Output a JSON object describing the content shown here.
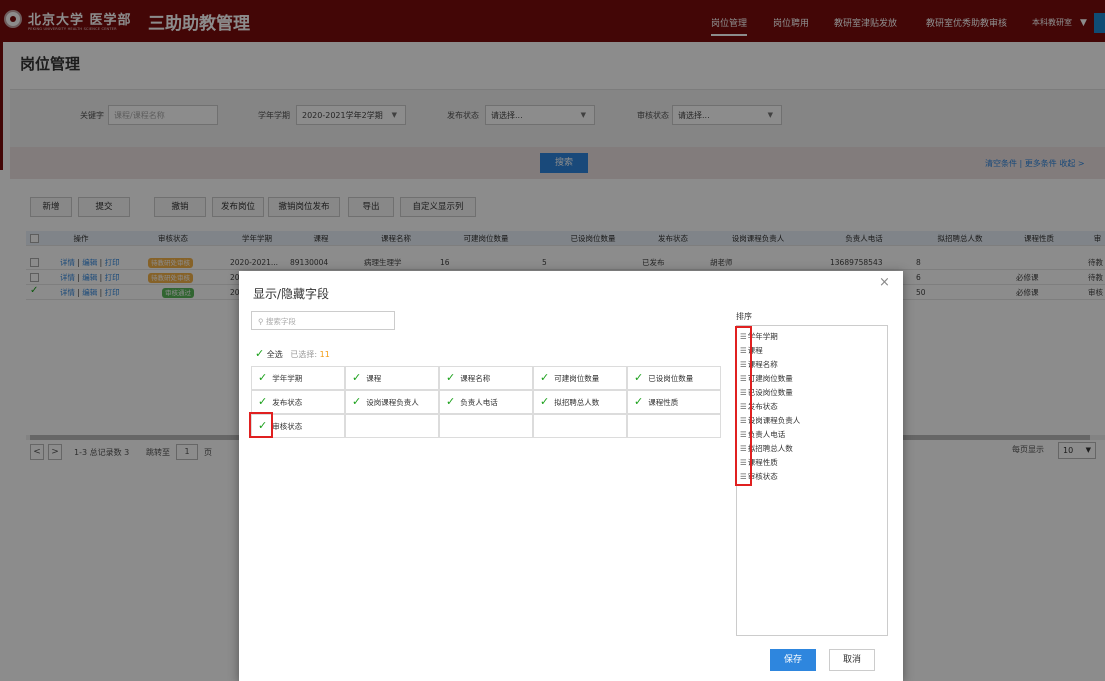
{
  "header": {
    "brand": "北京大学 医学部",
    "brand_sub": "PEKING UNIVERSITY HEALTH SCIENCE CENTER",
    "app_title": "三助助教管理",
    "nav": [
      "岗位管理",
      "岗位聘用",
      "教研室津贴发放",
      "教研室优秀助教审核",
      "本科教研室"
    ],
    "nav_caret": "▼"
  },
  "page": {
    "title": "岗位管理"
  },
  "filters": {
    "keyword_label": "关键字",
    "keyword_placeholder": "课程/课程名称",
    "term_label": "学年学期",
    "term_value": "2020-2021学年2学期",
    "publish_label": "发布状态",
    "publish_value": "请选择...",
    "review_label": "审核状态",
    "review_value": "请选择...",
    "search_button": "搜索",
    "links": "清空条件 | 更多条件  收起 >"
  },
  "toolbar": [
    "新增",
    "提交",
    "撤销",
    "发布岗位",
    "撤销岗位发布",
    "导出",
    "自定义显示列"
  ],
  "table": {
    "headers": [
      "操作",
      "审核状态",
      "学年学期",
      "课程",
      "课程名称",
      "可建岗位数量",
      "已设岗位数量",
      "发布状态",
      "设岗课程负责人",
      "负责人电话",
      "拟招聘总人数",
      "课程性质",
      "审"
    ],
    "rows": [
      {
        "ops": [
          "详情",
          "编辑",
          "打印"
        ],
        "status": "待教研处审核",
        "term": "2020-2021...",
        "course": "89130004",
        "name": "病理生理学",
        "can": "16",
        "set": "5",
        "pub": "已发布",
        "owner": "胡老师",
        "phone": "13689758543",
        "total": "8",
        "nature": "",
        "last": "待教"
      },
      {
        "ops": [
          "详情",
          "编辑",
          "打印"
        ],
        "status": "待教研处审核",
        "term": "20",
        "course": "",
        "name": "",
        "can": "",
        "set": "",
        "pub": "",
        "owner": "",
        "phone": "",
        "total": "6",
        "nature": "必修课",
        "last": "待教"
      },
      {
        "ops": [
          "详情",
          "编辑",
          "打印"
        ],
        "status": "审核通过",
        "term": "20",
        "course": "",
        "name": "",
        "can": "",
        "set": "",
        "pub": "",
        "owner": "",
        "phone": "",
        "total": "50",
        "nature": "必修课",
        "last": "审核"
      }
    ]
  },
  "pager": {
    "prev": "<",
    "next": ">",
    "summary": "1-3 总记录数 3",
    "goto_label": "跳转至",
    "goto_value": "1",
    "page_unit": "页",
    "per_page_label": "每页显示",
    "per_page_value": "10"
  },
  "modal": {
    "title": "显示/隐藏字段",
    "close": "×",
    "search_placeholder": "搜索字段",
    "select_all": "全选",
    "selected_label": "已选择:",
    "selected_count": "11",
    "fields": [
      "学年学期",
      "课程",
      "课程名称",
      "可建岗位数量",
      "已设岗位数量",
      "发布状态",
      "设岗课程负责人",
      "负责人电话",
      "拟招聘总人数",
      "课程性质",
      "审核状态"
    ],
    "sort_label": "排序",
    "sort_items": [
      "学年学期",
      "课程",
      "课程名称",
      "可建岗位数量",
      "已设岗位数量",
      "发布状态",
      "设岗课程负责人",
      "负责人电话",
      "拟招聘总人数",
      "课程性质",
      "审核状态"
    ],
    "save": "保存",
    "cancel": "取消"
  },
  "colors": {
    "brand": "#7b0c0c",
    "accent": "#2e86de",
    "check": "#1aa01a",
    "highlight": "#e02020"
  }
}
